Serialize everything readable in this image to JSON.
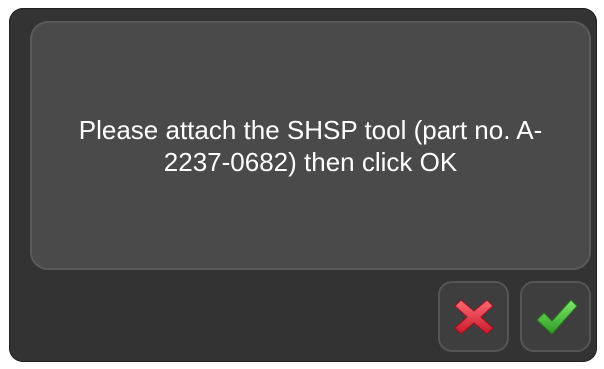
{
  "dialog": {
    "message": "Please attach the SHSP tool (part no. A-2237-0682) then click OK",
    "cancel_icon": "red-x-icon",
    "ok_icon": "green-check-icon"
  },
  "colors": {
    "background": "#333333",
    "panel": "#4a4a4a",
    "cancel": "#e8353f",
    "ok": "#3fbf3a"
  }
}
